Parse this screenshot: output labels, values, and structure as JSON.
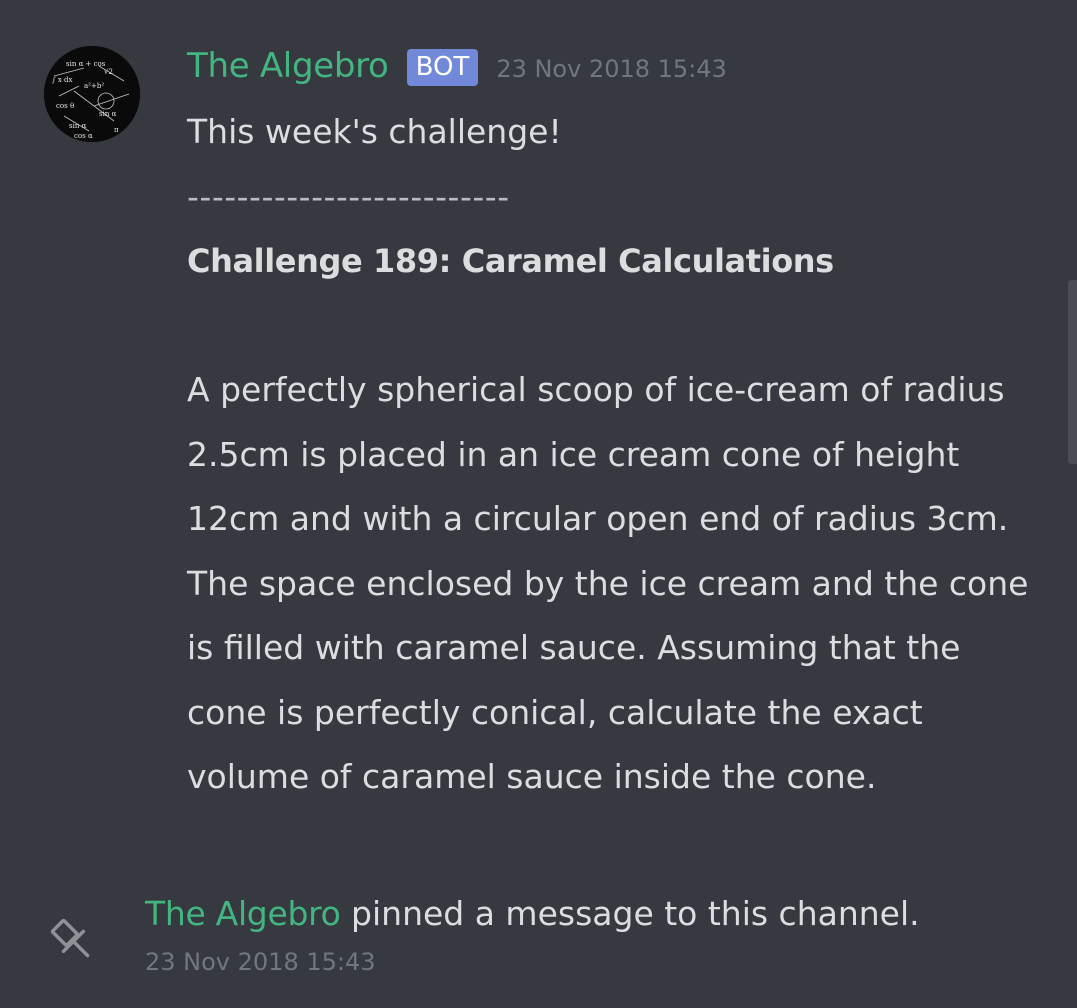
{
  "message": {
    "author": "The Algebro",
    "bot_tag": "BOT",
    "timestamp": "23 Nov 2018 15:43",
    "lines": {
      "intro": "This week's challenge!",
      "divider": "--------------------------",
      "title": "Challenge 189: Caramel Calculations",
      "body": "A perfectly spherical scoop of ice-cream of radius 2.5cm is placed in an ice cream cone of height 12cm and with a circular open end of radius 3cm. The space enclosed by the ice cream and the cone is filled with caramel sauce. Assuming that the cone is perfectly conical, calculate the exact volume of caramel sauce inside the cone."
    }
  },
  "system_message": {
    "author": "The Algebro",
    "text": " pinned a message to this channel.",
    "timestamp": "23 Nov 2018 15:43"
  },
  "colors": {
    "background": "#36393f",
    "username": "#43b581",
    "bot_tag": "#7289da",
    "text": "#dcddde",
    "muted": "#72767d"
  },
  "icons": {
    "avatar": "avatar-math-pattern",
    "pin": "pin-icon"
  }
}
